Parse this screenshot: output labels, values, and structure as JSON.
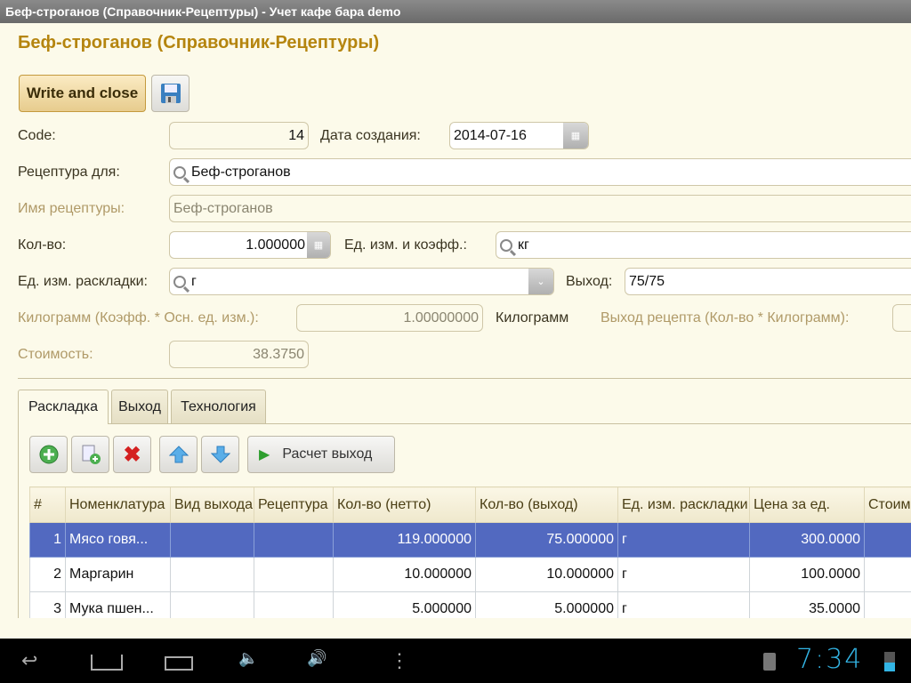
{
  "window_title": "Беф-строганов (Справочник-Рецептуры) - Учет кафе бара demo",
  "page_title": "Беф-строганов (Справочник-Рецептуры)",
  "toolbar": {
    "write_close": "Write and close",
    "save_icon": "floppy-disk-icon"
  },
  "form": {
    "code_label": "Code:",
    "code": "14",
    "date_label": "Дата создания:",
    "date": "2014-07-16",
    "recipe_for_label": "Рецептура для:",
    "recipe_for": "Беф-строганов",
    "recipe_name_label": "Имя рецептуры:",
    "recipe_name": "Беф-строганов",
    "qty_label": "Кол-во:",
    "qty": "1.000000",
    "unit_coef_label": "Ед. изм. и коэфф.:",
    "unit_coef": "кг",
    "layout_unit_label": "Ед. изм. раскладки:",
    "layout_unit": "г",
    "output_label": "Выход:",
    "output": "75/75",
    "kg_label": "Килограмм (Коэфф. * Осн. ед. изм.):",
    "kg": "1.00000000",
    "kg_unit": "Килограмм",
    "recipe_output_label": "Выход рецепта (Кол-во * Килограмм):",
    "cost_label": "Стоимость:",
    "cost": "38.3750"
  },
  "tabs": [
    "Раскладка",
    "Выход",
    "Технология"
  ],
  "table_toolbar": {
    "calc_label": "Расчет выход"
  },
  "table": {
    "columns": [
      "#",
      "Номенклатура",
      "Вид выхода",
      "Рецептура",
      "Кол-во (нетто)",
      "Кол-во (выход)",
      "Ед. изм. раскладки",
      "Цена за ед.",
      "Стоимость"
    ],
    "rows": [
      {
        "n": "1",
        "item": "Мясо говя...",
        "net": "119.000000",
        "out": "75.000000",
        "unit": "г",
        "price": "300.0000"
      },
      {
        "n": "2",
        "item": "Маргарин",
        "net": "10.000000",
        "out": "10.000000",
        "unit": "г",
        "price": "100.0000"
      },
      {
        "n": "3",
        "item": "Мука пшен...",
        "net": "5.000000",
        "out": "5.000000",
        "unit": "г",
        "price": "35.0000"
      }
    ]
  },
  "status": {
    "time": "7:34"
  }
}
